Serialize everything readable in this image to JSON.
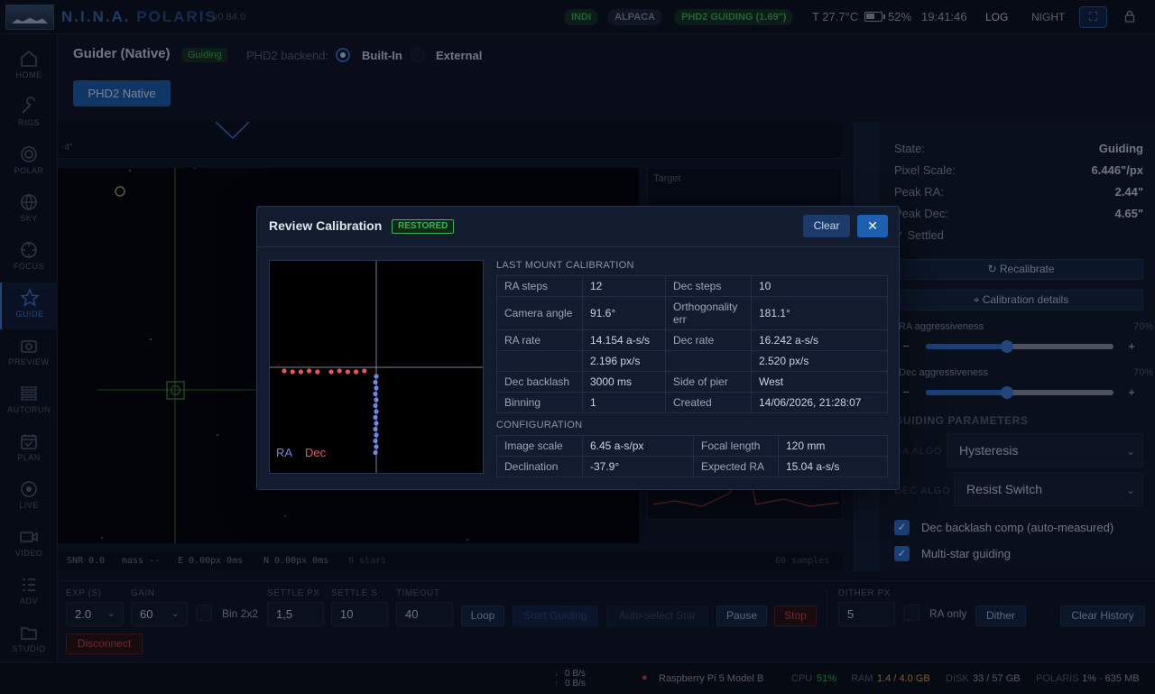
{
  "topbar": {
    "brand_a": "N.I.N.A.",
    "brand_b": "POLARIS",
    "version": "v0.84.0",
    "pills": [
      "INDI",
      "ALPACA",
      "PHD2 GUIDING (1.69\")"
    ],
    "temp": "T 27.7°C",
    "battery": "52%",
    "time": "19:41:46",
    "log": "LOG",
    "night": "NIGHT"
  },
  "sidebar": {
    "items": [
      {
        "label": "HOME",
        "icon": "home-icon"
      },
      {
        "label": "RIGS",
        "icon": "wrench-icon"
      },
      {
        "label": "POLAR",
        "icon": "target-icon"
      },
      {
        "label": "SKY",
        "icon": "globe-icon"
      },
      {
        "label": "FOCUS",
        "icon": "focus-icon"
      },
      {
        "label": "GUIDE",
        "icon": "star-icon"
      },
      {
        "label": "PREVIEW",
        "icon": "camera-icon"
      },
      {
        "label": "AUTORUN",
        "icon": "stack-icon"
      },
      {
        "label": "PLAN",
        "icon": "calendar-icon"
      },
      {
        "label": "LIVE",
        "icon": "live-icon"
      },
      {
        "label": "VIDEO",
        "icon": "video-icon"
      },
      {
        "label": "ADV",
        "icon": "list-icon"
      },
      {
        "label": "STUDIO",
        "icon": "folder-icon"
      }
    ],
    "active": "GUIDE"
  },
  "header": {
    "title": "Guider (Native)",
    "state_badge": "Guiding",
    "backend_label": "PHD2 backend:",
    "backend_options": [
      "Built-In",
      "External"
    ],
    "backend_selected": "Built-In",
    "mode_button": "PHD2 Native"
  },
  "graph": {
    "axis_label": "-4\""
  },
  "target": {
    "label": "Target"
  },
  "status_strip": {
    "snr": "SNR 0.0",
    "mass": "mass --",
    "e": "E 0.00px 0ms",
    "n": "N 0.00px 0ms",
    "stars": "0 stars",
    "samples": "60 samples"
  },
  "right_panel": {
    "state_label": "State:",
    "state_value": "Guiding",
    "pixel_scale_label": "Pixel Scale:",
    "pixel_scale_value": "6.446\"/px",
    "peak_ra_label": "Peak RA:",
    "peak_ra_value": "2.44\"",
    "peak_dec_label": "Peak Dec:",
    "peak_dec_value": "4.65\"",
    "settled": "✓ Settled",
    "recalibrate": "↻ Recalibrate",
    "calibration_details": "⌖ Calibration details",
    "ra_aggr_label": "RA aggressiveness",
    "ra_aggr_pct": "70%",
    "ra_aggr_value": 0.7,
    "dec_aggr_label": "Dec aggressiveness",
    "dec_aggr_pct": "70%",
    "dec_aggr_value": 0.7,
    "guiding_params_title": "GUIDING PARAMETERS",
    "ra_algo_label": "RA ALGO",
    "ra_algo_value": "Hysteresis",
    "dec_algo_label": "DEC ALGO",
    "dec_algo_value": "Resist Switch",
    "check1": "Dec backlash comp (auto-measured)",
    "check2": "Multi-star guiding"
  },
  "controls": {
    "exp_label": "EXP (S)",
    "exp_value": "2.0",
    "gain_label": "GAIN",
    "gain_value": "60",
    "bin_label": "Bin 2x2",
    "settle_px_label": "SETTLE PX",
    "settle_px_value": "1,5",
    "settle_s_label": "SETTLE S",
    "settle_s_value": "10",
    "timeout_label": "TIMEOUT",
    "timeout_value": "40",
    "loop": "Loop",
    "start_guiding": "Start Guiding",
    "auto_select": "Auto-select Star",
    "pause": "Pause",
    "stop": "Stop",
    "dither_px_label": "DITHER PX",
    "dither_px_value": "5",
    "ra_only": "RA only",
    "dither": "Dither",
    "clear_history": "Clear History",
    "disconnect": "Disconnect"
  },
  "footer": {
    "down_rate": "0 B/s",
    "up_rate": "0 B/s",
    "device": "Raspberry Pi 5 Model B",
    "cpu_label": "CPU",
    "cpu_value": "51%",
    "ram_label": "RAM",
    "ram_value": "1.4 / 4.0 GB",
    "disk_label": "DISK",
    "disk_value": "33 / 57 GB",
    "polaris_label": "POLARIS",
    "polaris_value": "1% · 635 MB"
  },
  "modal": {
    "title": "Review Calibration",
    "badge": "RESTORED",
    "clear": "Clear",
    "close": "✕",
    "plot_ra_label": "RA",
    "plot_dec_label": "Dec",
    "colors": {
      "ra": "#6f86e8",
      "dec": "#e85555"
    },
    "last_cal_title": "LAST MOUNT CALIBRATION",
    "last_cal_rows": [
      [
        "RA steps",
        "12",
        "Dec steps",
        "10"
      ],
      [
        "Camera angle",
        "91.6°",
        "Orthogonality err",
        "181.1°"
      ],
      [
        "RA rate",
        "14.154 a-s/s",
        "Dec rate",
        "16.242 a-s/s"
      ],
      [
        "",
        "2.196 px/s",
        "",
        "2.520 px/s"
      ],
      [
        "Dec backlash",
        "3000 ms",
        "Side of pier",
        "West"
      ],
      [
        "Binning",
        "1",
        "Created",
        "14/06/2026, 21:28:07"
      ]
    ],
    "config_title": "CONFIGURATION",
    "config_rows": [
      [
        "Image scale",
        "6.45 a-s/px",
        "Focal length",
        "120 mm"
      ],
      [
        "Declination",
        "-37.9°",
        "Expected RA",
        "15.04 a-s/s"
      ]
    ]
  }
}
